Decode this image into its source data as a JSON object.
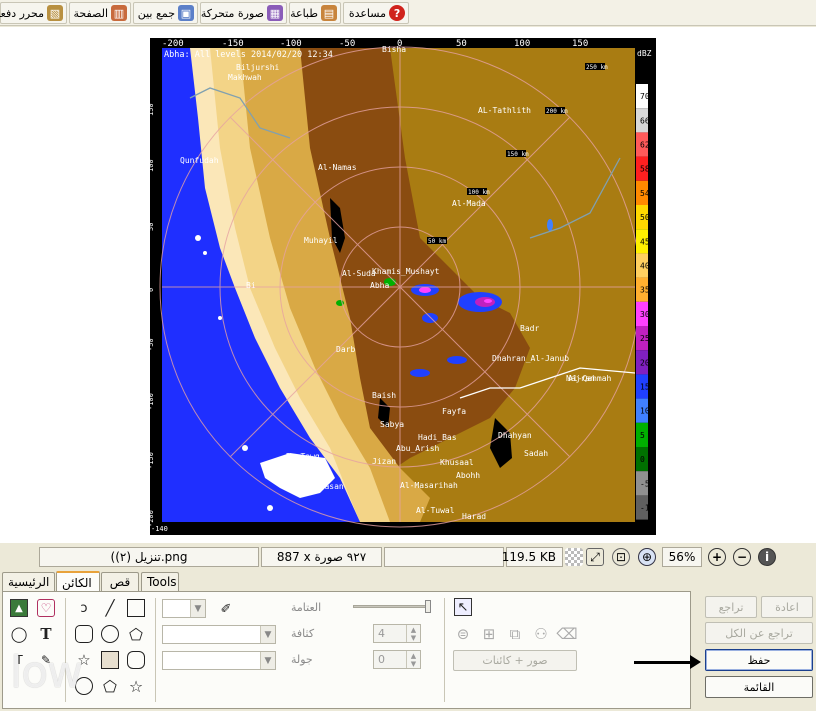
{
  "toolbar": {
    "items": [
      {
        "label": "مساعدة",
        "icon": "help-icon"
      },
      {
        "label": "طباعة",
        "icon": "print-icon"
      },
      {
        "label": "صورة متحركة",
        "icon": "animation-icon"
      },
      {
        "label": "جمع بين",
        "icon": "combine-icon"
      },
      {
        "label": "الصفحة",
        "icon": "page-icon"
      },
      {
        "label": "محرر دفعة",
        "icon": "batch-editor-icon"
      }
    ]
  },
  "radar": {
    "header": "Abha: All levels 2014/02/20 12:34",
    "unit": "dBZ",
    "top_ticks": [
      "-200",
      "-150",
      "-100",
      "-50",
      "0",
      "50",
      "100",
      "150"
    ],
    "left_ticks": [
      "150",
      "100",
      "50",
      "0",
      "-50",
      "-100",
      "-150",
      "-200"
    ],
    "corner_label": "-140",
    "range_labels": [
      "200 km",
      "150 km",
      "100 km",
      "50 km",
      "250 km"
    ],
    "places": [
      "Bisha",
      "Biljurshi",
      "Makhwah",
      "AL-Tathlith",
      "Qunfudah",
      "Al-Namas",
      "Al-Mada",
      "Muhayil",
      "Al-Suda",
      "Khamis_Mushayt",
      "Abha",
      "Al-Qahmah",
      "Darb",
      "Badr",
      "Dhahran_Al-Janub",
      "Najran",
      "Baish",
      "Sabya",
      "Fayfa",
      "Hadi_Bas",
      "Abu_Arish",
      "Khusaal",
      "Abohh",
      "Jizan",
      "Dhahyan",
      "Sadah",
      "Al-Masarihah",
      "Al-Tuwal",
      "Harad",
      "Du_Tawq",
      "Farasan",
      "Bi"
    ],
    "scale": [
      {
        "label": "70",
        "color": "#ffffff"
      },
      {
        "label": "66",
        "color": "#d8d8d8"
      },
      {
        "label": "62",
        "color": "#ff5a5a"
      },
      {
        "label": "58",
        "color": "#ff2020"
      },
      {
        "label": "54",
        "color": "#ff8a00"
      },
      {
        "label": "50",
        "color": "#ffd800"
      },
      {
        "label": "45",
        "color": "#fff000"
      },
      {
        "label": "40",
        "color": "#ffd060"
      },
      {
        "label": "35",
        "color": "#ffb030"
      },
      {
        "label": "30",
        "color": "#ff40ff"
      },
      {
        "label": "25",
        "color": "#c020c0"
      },
      {
        "label": "20",
        "color": "#8020c0"
      },
      {
        "label": "15",
        "color": "#2040ff"
      },
      {
        "label": "10",
        "color": "#4080ff"
      },
      {
        "label": "5",
        "color": "#00b000"
      },
      {
        "label": "0",
        "color": "#007000"
      },
      {
        "label": "-5",
        "color": "#909090"
      },
      {
        "label": "-10",
        "color": "#606060"
      }
    ]
  },
  "status": {
    "filename": "(تنزيل (٢).png",
    "dims": "887 x ٩٢٧ صورة",
    "empty": "",
    "size": "119.5 KB",
    "zoom": "56%"
  },
  "tabs": [
    "الرئيسية",
    "الكائن",
    "قص",
    "Tools"
  ],
  "panel": {
    "opacity_label": "العتامة",
    "thickness_label": "كثافة",
    "round_label": "جولة",
    "thickness_value": "4",
    "round_value": "0",
    "photos_objects": "صور + كائنات"
  },
  "right_buttons": {
    "redo": "اعادة",
    "undo": "تراجع",
    "undo_all": "تراجع عن الكل",
    "save": "حفظ",
    "menu": "القائمة"
  },
  "watermark": "low"
}
